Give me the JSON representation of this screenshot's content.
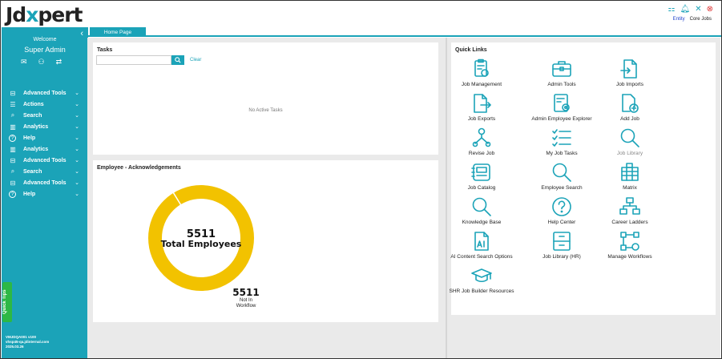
{
  "brand": {
    "prefix": "Jd",
    "x": "x",
    "suffix": "pert"
  },
  "topbar": {
    "entity": "Entity",
    "core_jobs": "Core Jobs"
  },
  "sidebar": {
    "welcome": "Welcome",
    "user": "Super Admin",
    "nav": [
      {
        "label": "Advanced Tools",
        "icon": "toolbox-icon"
      },
      {
        "label": "Actions",
        "icon": "list-icon"
      },
      {
        "label": "Search",
        "icon": "search-icon"
      },
      {
        "label": "Analytics",
        "icon": "analytics-icon"
      },
      {
        "label": "Help",
        "icon": "help-icon"
      },
      {
        "label": "Analytics",
        "icon": "analytics-icon"
      },
      {
        "label": "Advanced Tools",
        "icon": "toolbox-icon"
      },
      {
        "label": "Search",
        "icon": "search-icon"
      },
      {
        "label": "Advanced Tools",
        "icon": "toolbox-icon"
      },
      {
        "label": "Help",
        "icon": "help-icon"
      }
    ],
    "quick_tips": "Quick Tips",
    "version": [
      "VMJDQA001 v100",
      "vhsp45-qa.jdinternal.com",
      "2025.03.26"
    ]
  },
  "tabs": [
    {
      "label": "Home Page",
      "active": true
    }
  ],
  "tasks": {
    "title": "Tasks",
    "search_value": "",
    "clear": "Clear",
    "empty": "No Active Tasks"
  },
  "ack": {
    "title": "Employee - Acknowledgements",
    "center_value": "5511",
    "center_label": "Total Employees",
    "slice_value": "5511",
    "slice_label_line1": "Not In",
    "slice_label_line2": "Workflow"
  },
  "chart_data": {
    "type": "pie",
    "categories": [
      "Not In Workflow"
    ],
    "values": [
      5511
    ],
    "total": 5511,
    "colors": [
      "#f2c200"
    ]
  },
  "quick_links": {
    "title": "Quick Links",
    "items": [
      {
        "label": "Job Management",
        "icon": "job-management-icon"
      },
      {
        "label": "Admin Tools",
        "icon": "briefcase-icon"
      },
      {
        "label": "Job Imports",
        "icon": "import-icon"
      },
      {
        "label": "Job Exports",
        "icon": "export-icon"
      },
      {
        "label": "Admin Employee Explorer",
        "icon": "employee-explorer-icon"
      },
      {
        "label": "Add Job",
        "icon": "add-document-icon"
      },
      {
        "label": "Revise Job",
        "icon": "org-icon"
      },
      {
        "label": "My Job Tasks",
        "icon": "task-list-icon"
      },
      {
        "label": "Job Library",
        "icon": "search-icon",
        "muted": true
      },
      {
        "label": "Job Catalog",
        "icon": "catalog-icon"
      },
      {
        "label": "Employee Search",
        "icon": "search-icon"
      },
      {
        "label": "Matrix",
        "icon": "matrix-icon"
      },
      {
        "label": "Knowledge Base",
        "icon": "search-icon"
      },
      {
        "label": "Help Center",
        "icon": "help-icon"
      },
      {
        "label": "Career Ladders",
        "icon": "hierarchy-icon"
      },
      {
        "label": "AI Content Search Options",
        "icon": "ai-document-icon"
      },
      {
        "label": "Job Library (HR)",
        "icon": "cabinet-icon"
      },
      {
        "label": "Manage Workflows",
        "icon": "workflow-icon"
      },
      {
        "label": "SHR Job Builder Resources",
        "icon": "graduation-cap-icon"
      }
    ]
  },
  "colors": {
    "accent": "#1ba3b8",
    "donut": "#f2c200",
    "quick_tips": "#2db845"
  }
}
